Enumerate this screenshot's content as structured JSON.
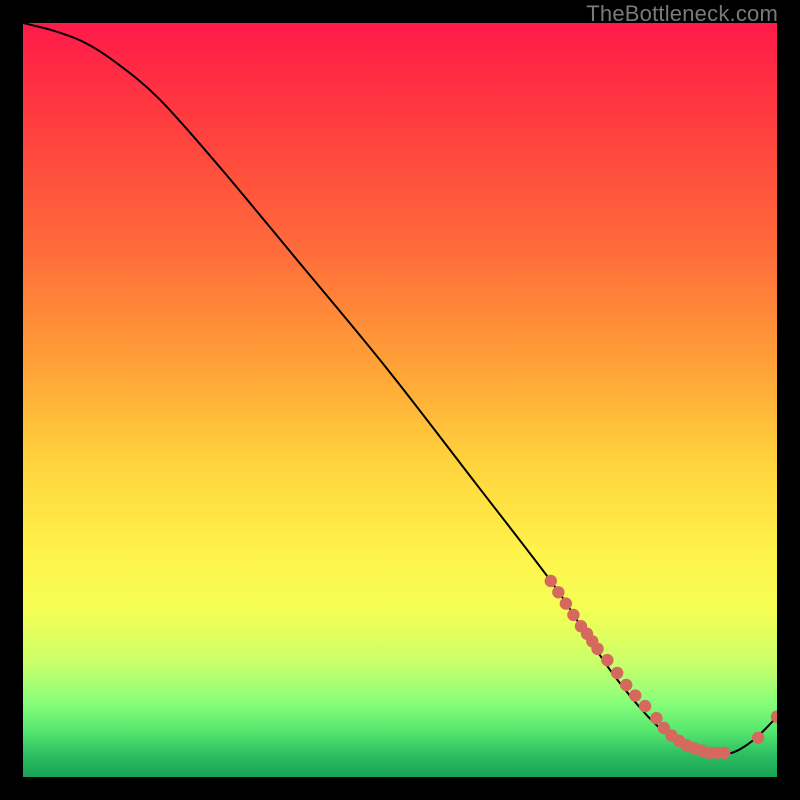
{
  "watermark": "TheBottleneck.com",
  "chart_data": {
    "type": "line",
    "title": "",
    "xlabel": "",
    "ylabel": "",
    "xlim": [
      0,
      100
    ],
    "ylim": [
      0,
      100
    ],
    "series": [
      {
        "name": "curve",
        "x": [
          0,
          4,
          8,
          12,
          18,
          26,
          36,
          48,
          60,
          70,
          74,
          78,
          82,
          85,
          88,
          91,
          94,
          97,
          100
        ],
        "y": [
          100,
          99,
          97.5,
          95,
          90,
          81,
          69,
          54.5,
          39,
          26,
          20,
          14,
          9,
          6,
          4,
          3.2,
          3.2,
          5,
          8
        ]
      }
    ],
    "points": {
      "name": "highlighted-points",
      "color": "#d5695d",
      "x": [
        70,
        71,
        72,
        73,
        74,
        74.8,
        75.5,
        76.2,
        77.5,
        78.8,
        80,
        81.2,
        82.5,
        84,
        85,
        86,
        87,
        88,
        89,
        90,
        91,
        92,
        93,
        97.5,
        100
      ],
      "y": [
        26,
        24.5,
        23,
        21.5,
        20,
        19,
        18,
        17,
        15.5,
        13.8,
        12.2,
        10.8,
        9.4,
        7.8,
        6.5,
        5.5,
        4.8,
        4.2,
        3.8,
        3.5,
        3.2,
        3.2,
        3.2,
        5.2,
        8
      ]
    }
  }
}
